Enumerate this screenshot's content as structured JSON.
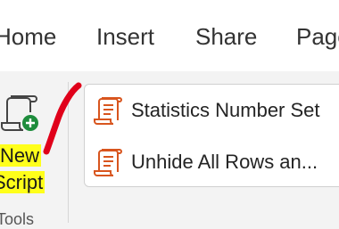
{
  "tabs": [
    "Home",
    "Insert",
    "Share",
    "Page"
  ],
  "new_script": {
    "label_line1": "New",
    "label_line2": "Script",
    "icon": "new-script-icon"
  },
  "group": {
    "label": "Tools"
  },
  "scripts": [
    {
      "label": "Statistics Number Set",
      "icon": "script-icon"
    },
    {
      "label": "Unhide All Rows an...",
      "icon": "script-icon"
    }
  ],
  "colors": {
    "highlight": "#ffff1a",
    "script_icon": "#d8551e",
    "annotation": "#e0001a",
    "add_badge": "#1e8c3c"
  }
}
